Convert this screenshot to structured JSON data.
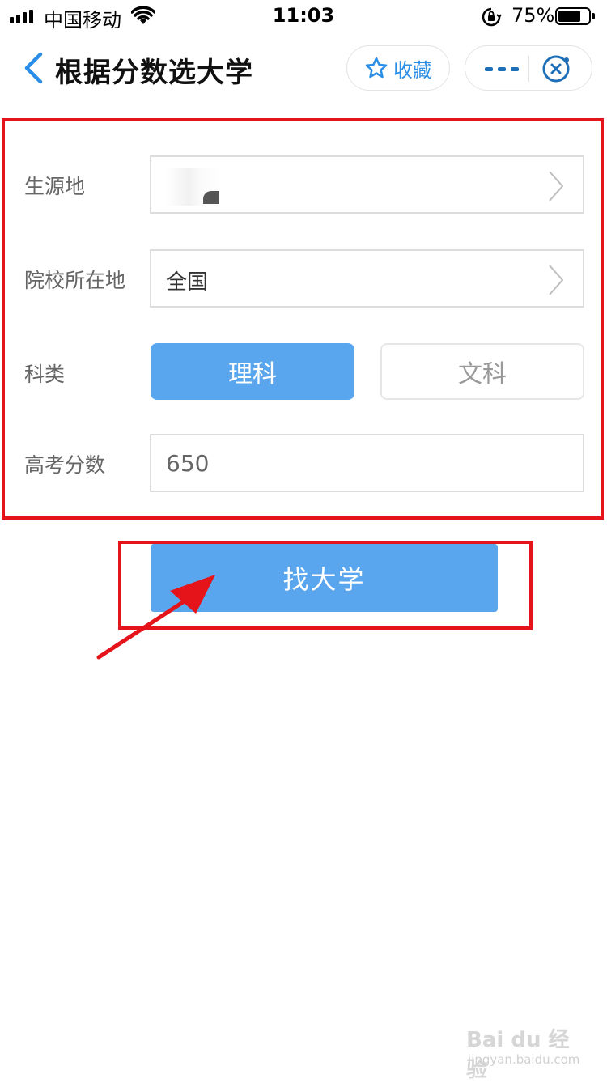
{
  "status_bar": {
    "carrier": "中国移动",
    "time": "11:03",
    "battery_percent": "75%",
    "battery_level": 0.75
  },
  "nav": {
    "title": "根据分数选大学",
    "favorite_label": "收藏",
    "icons": {
      "back": "back-chevron-icon",
      "favorite": "star-icon",
      "more": "more-dots-icon",
      "close": "miniprogram-close-icon"
    }
  },
  "form": {
    "origin": {
      "label": "生源地",
      "value": ""
    },
    "school_location": {
      "label": "院校所在地",
      "value": "全国"
    },
    "subject": {
      "label": "科类",
      "options": [
        "理科",
        "文科"
      ],
      "selected": "理科"
    },
    "score": {
      "label": "高考分数",
      "value": "650"
    }
  },
  "submit_label": "找大学",
  "watermark": {
    "main": "Bai du 经验",
    "sub": "jingyan.baidu.com"
  },
  "colors": {
    "accent": "#5aa6ee",
    "link": "#2a8ee6",
    "highlight": "#e5141b"
  }
}
